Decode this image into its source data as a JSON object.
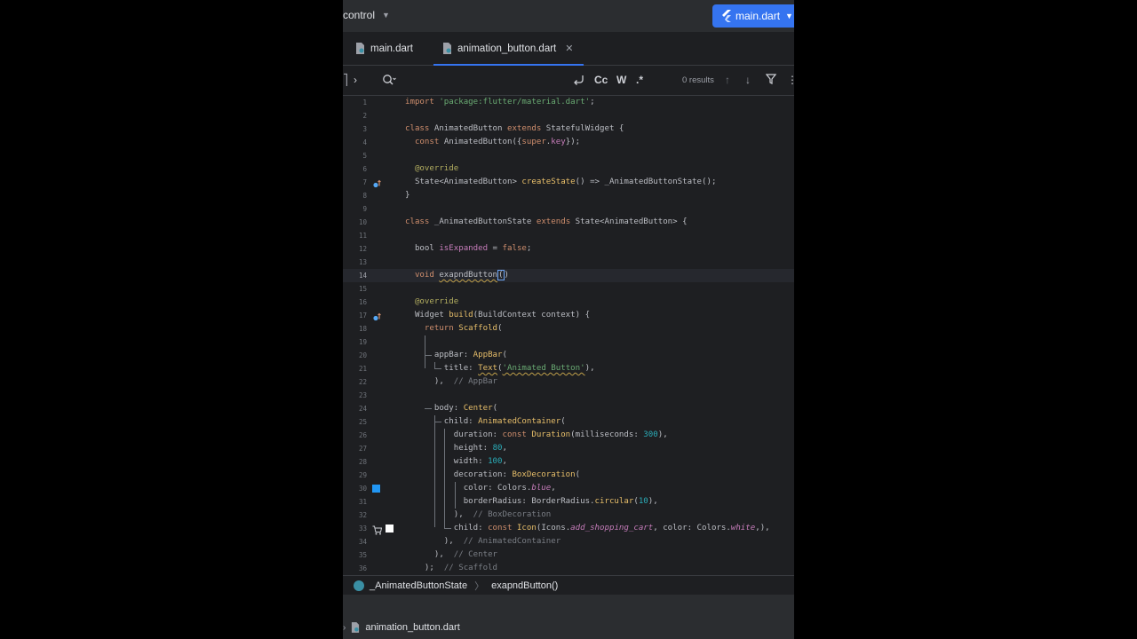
{
  "titlebar": {
    "vcs_label": "control",
    "run_config": "main.dart"
  },
  "tabs": [
    {
      "label": "main.dart",
      "active": false
    },
    {
      "label": "animation_button.dart",
      "active": true
    }
  ],
  "find": {
    "results": "0 results"
  },
  "editor": {
    "current_line": 14,
    "line_numbers": [
      "1",
      "2",
      "3",
      "4",
      "5",
      "6",
      "7",
      "8",
      "9",
      "10",
      "11",
      "12",
      "13",
      "14",
      "15",
      "16",
      "17",
      "18",
      "19",
      "20",
      "21",
      "22",
      "23",
      "24",
      "25",
      "26",
      "27",
      "28",
      "29",
      "30",
      "31",
      "32",
      "33",
      "34",
      "35",
      "36"
    ],
    "lines": [
      "import 'package:flutter/material.dart';",
      "",
      "class AnimatedButton extends StatefulWidget {",
      "  const AnimatedButton({super.key});",
      "",
      "  @override",
      "  State<AnimatedButton> createState() => _AnimatedButtonState();",
      "}",
      "",
      "class _AnimatedButtonState extends State<AnimatedButton> {",
      "",
      "  bool isExpanded = false;",
      "",
      "  void exapndButton()",
      "",
      "  @override",
      "  Widget build(BuildContext context) {",
      "    return Scaffold(",
      "",
      "      appBar: AppBar(",
      "        title: Text('Animated Button'),",
      "      ),  // AppBar",
      "",
      "      body: Center(",
      "        child: AnimatedContainer(",
      "          duration: const Duration(milliseconds: 300),",
      "          height: 80,",
      "          width: 100,",
      "          decoration: BoxDecoration(",
      "            color: Colors.blue,",
      "            borderRadius: BorderRadius.circular(10),",
      "          ),  // BoxDecoration",
      "          child: const Icon(Icons.add_shopping_cart, color: Colors.white,),",
      "        ),  // AnimatedContainer",
      "      ),  // Center",
      "    );  // Scaffold"
    ]
  },
  "breadcrumbs": {
    "class_name": "_AnimatedButtonState",
    "method_name": "exapndButton()"
  },
  "statusbar": {
    "file": "animation_button.dart"
  },
  "colors": {
    "accent": "#3574f0",
    "background": "#1e1f22",
    "keyword": "#cf8e6d",
    "string": "#6aab73",
    "number": "#2aacb8",
    "annotation": "#b3ae60",
    "function": "#56a8f5",
    "property": "#c77dbb",
    "comment": "#7a7e85"
  },
  "icons": [
    "flutter-icon",
    "dart-file-icon",
    "search-icon",
    "wrap-icon",
    "filter-icon",
    "override-icon",
    "color-swatch-icon",
    "cart-icon"
  ]
}
